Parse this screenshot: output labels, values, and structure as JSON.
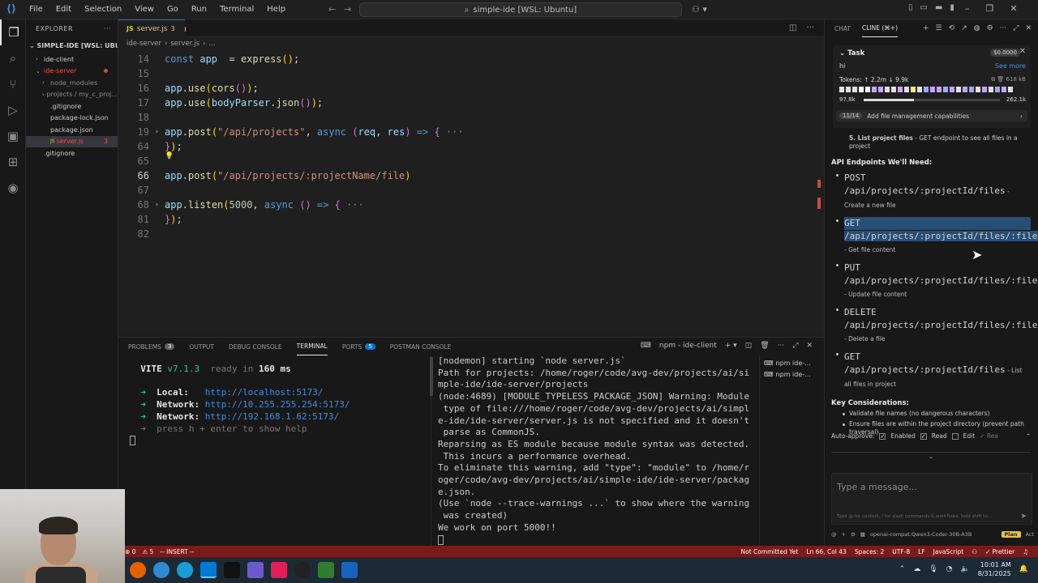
{
  "titlebar": {
    "menu": [
      "File",
      "Edit",
      "Selection",
      "View",
      "Go",
      "Run",
      "Terminal",
      "Help"
    ],
    "search": "simple-ide [WSL: Ubuntu]"
  },
  "explorer": {
    "header": "EXPLORER",
    "section": "SIMPLE-IDE [WSL: UBUNTU]",
    "items": [
      {
        "label": "ide-client",
        "indent": 1,
        "folder": true,
        "open": false
      },
      {
        "label": "ide-server",
        "indent": 1,
        "folder": true,
        "open": true
      },
      {
        "label": "node_modules",
        "indent": 2,
        "folder": true,
        "open": false
      },
      {
        "label": "projects / my_c_proj...",
        "indent": 2,
        "folder": true,
        "open": false
      },
      {
        "label": ".gitignore",
        "indent": 2,
        "folder": false
      },
      {
        "label": "package-lock.json",
        "indent": 2,
        "folder": false
      },
      {
        "label": "package.json",
        "indent": 2,
        "folder": false
      },
      {
        "label": "server.js",
        "indent": 2,
        "folder": false,
        "count": "3"
      },
      {
        "label": ".gitignore",
        "indent": 1,
        "folder": false
      }
    ]
  },
  "editor": {
    "tab": {
      "label": "server.js",
      "problems": "3"
    },
    "breadcrumb": [
      "ide-server",
      "server.js",
      "..."
    ],
    "lines": [
      {
        "n": "14",
        "fold": "",
        "segs": [
          [
            "kw",
            "const "
          ],
          [
            "var",
            "app"
          ],
          [
            "",
            "  = "
          ],
          [
            "fn",
            "express"
          ],
          [
            "pn",
            "()"
          ],
          [
            "",
            ";"
          ]
        ]
      },
      {
        "n": "15",
        "fold": "",
        "segs": []
      },
      {
        "n": "16",
        "fold": "",
        "segs": [
          [
            "var",
            "app"
          ],
          [
            "",
            "."
          ],
          [
            "fn",
            "use"
          ],
          [
            "pn",
            "("
          ],
          [
            "fn",
            "cors"
          ],
          [
            "pn2",
            "()"
          ],
          [
            "pn",
            ")"
          ],
          [
            "",
            ";"
          ]
        ]
      },
      {
        "n": "17",
        "fold": "",
        "segs": [
          [
            "var",
            "app"
          ],
          [
            "",
            "."
          ],
          [
            "fn",
            "use"
          ],
          [
            "pn",
            "("
          ],
          [
            "var",
            "bodyParser"
          ],
          [
            "",
            "."
          ],
          [
            "fn",
            "json"
          ],
          [
            "pn2",
            "()"
          ],
          [
            "pn",
            ")"
          ],
          [
            "",
            ";"
          ]
        ]
      },
      {
        "n": "18",
        "fold": "",
        "segs": []
      },
      {
        "n": "19",
        "fold": "›",
        "segs": [
          [
            "var",
            "app"
          ],
          [
            "",
            "."
          ],
          [
            "fn",
            "post"
          ],
          [
            "pn",
            "("
          ],
          [
            "str",
            "\"/api/projects\""
          ],
          [
            "",
            ", "
          ],
          [
            "kw",
            "async "
          ],
          [
            "pn2",
            "("
          ],
          [
            "var",
            "req"
          ],
          [
            "",
            ", "
          ],
          [
            "var",
            "res"
          ],
          [
            "pn2",
            ") "
          ],
          [
            "kw",
            "=> "
          ],
          [
            "pn2",
            "{"
          ],
          [
            "cm",
            " ···"
          ]
        ]
      },
      {
        "n": "64",
        "fold": "",
        "segs": [
          [
            "pn2",
            "}"
          ],
          [
            "pn",
            ")"
          ],
          [
            "",
            ";"
          ]
        ]
      },
      {
        "n": "65",
        "fold": "",
        "segs": []
      },
      {
        "n": "66",
        "fold": "",
        "segs": [
          [
            "var",
            "app"
          ],
          [
            "",
            "."
          ],
          [
            "fn",
            "post"
          ],
          [
            "pn",
            "("
          ],
          [
            "str",
            "\"/api/projects/:projectName/file"
          ],
          [
            "pn",
            ")"
          ]
        ],
        "current": true
      },
      {
        "n": "67",
        "fold": "",
        "segs": []
      },
      {
        "n": "68",
        "fold": "›",
        "segs": [
          [
            "var",
            "app"
          ],
          [
            "",
            "."
          ],
          [
            "fn",
            "listen"
          ],
          [
            "pn",
            "("
          ],
          [
            "num",
            "5000"
          ],
          [
            "",
            ", "
          ],
          [
            "kw",
            "async "
          ],
          [
            "pn2",
            "() "
          ],
          [
            "kw",
            "=> "
          ],
          [
            "pn2",
            "{"
          ],
          [
            "cm",
            " ···"
          ]
        ]
      },
      {
        "n": "81",
        "fold": "",
        "segs": [
          [
            "pn2",
            "}"
          ],
          [
            "pn",
            ")"
          ],
          [
            "",
            ";"
          ]
        ]
      },
      {
        "n": "82",
        "fold": "",
        "segs": []
      }
    ]
  },
  "panel": {
    "tabs": [
      {
        "label": "PROBLEMS",
        "badge": "3"
      },
      {
        "label": "OUTPUT"
      },
      {
        "label": "DEBUG CONSOLE"
      },
      {
        "label": "TERMINAL",
        "active": true
      },
      {
        "label": "PORTS",
        "badge": "5"
      },
      {
        "label": "POSTMAN CONSOLE"
      }
    ],
    "terminal_name": "npm - ide-client",
    "left_terminal": {
      "vite": "VITE",
      "version": "v7.1.3",
      "ready": "ready in",
      "ms": "160 ms",
      "local_label": "Local:",
      "local_url": "http://localhost:5173/",
      "net1_label": "Network:",
      "net1_url": "http://10.255.255.254:5173/",
      "net2_label": "Network:",
      "net2_url": "http://192.168.1.62:5173/",
      "help": "press h + enter to show help"
    },
    "right_terminal": [
      "[nodemon] starting `node server.js`",
      "Path for projects: /home/roger/code/avg-dev/projects/ai/si",
      "mple-ide/ide-server/projects",
      "(node:4689) [MODULE_TYPELESS_PACKAGE_JSON] Warning: Module",
      " type of file:///home/roger/code/avg-dev/projects/ai/simpl",
      "e-ide/ide-server/server.js is not specified and it doesn't",
      " parse as CommonJS.",
      "Reparsing as ES module because module syntax was detected.",
      " This incurs a performance overhead.",
      "To eliminate this warning, add \"type\": \"module\" to /home/r",
      "oger/code/avg-dev/projects/ai/simple-ide/ide-server/packag",
      "e.json.",
      "(Use `node --trace-warnings ...` to show where the warning",
      " was created)",
      "We work on port 5000!!"
    ],
    "sessions": [
      "npm ide-...",
      "npm ide-..."
    ]
  },
  "cline": {
    "tabs": [
      "CHAT",
      "CLINE (⌘+)"
    ],
    "task": {
      "title": "Task",
      "cost": "$0.0000",
      "message": "hi",
      "see_more": "See more",
      "tokens": "Tokens: ↑ 2.2m ↓ 9.9k",
      "size": "618 kB",
      "context_used": "97.8k",
      "context_max": "262.1k",
      "context_fraction": 0.37,
      "progress_pill": "11/14",
      "progress_label": "Add file management capabilities"
    },
    "step5_bold": "5. List project files",
    "step5_text": " - GET endpoint to see all files in a project",
    "endpoints_heading": "API Endpoints We'll Need:",
    "endpoints": [
      {
        "method": "POST",
        "path": "/api/projects/:projectId/files",
        "desc": "- Create a new file"
      },
      {
        "method": "GET",
        "path": "/api/projects/:projectId/files/:fileName",
        "desc": "- Get file content",
        "highlight": true
      },
      {
        "method": "PUT",
        "path": "/api/projects/:projectId/files/:fileName",
        "desc": "- Update file content"
      },
      {
        "method": "DELETE",
        "path": "/api/projects/:projectId/files/:fileName",
        "desc": "- Delete a file"
      },
      {
        "method": "GET",
        "path": "/api/projects/:projectId/files",
        "desc": "- List all files in project"
      }
    ],
    "considerations_heading": "Key Considerations:",
    "considerations": [
      "Validate file names (no dangerous characters)",
      "Ensure files are within the project directory (prevent path traversal)"
    ],
    "auto_approve": {
      "label": "Auto-approve:",
      "enabled": "Enabled",
      "read": "Read",
      "edit": "Edit",
      "rea": "Rea"
    },
    "input_placeholder": "Type a message...",
    "input_hint": "Type @ for context, / for slash commands & workflows, hold shift to...",
    "model": "openai-compat:Qwen3-Coder-30B-A3B",
    "plan": "Plan",
    "act": "Act"
  },
  "statusbar": {
    "errors": "⊗ 0",
    "warnings": "⚠ 5",
    "mode": "-- INSERT --",
    "git": "Not Committed Yet",
    "pos": "Ln 66, Col 43",
    "spaces": "Spaces: 2",
    "enc": "UTF-8",
    "eol": "LF",
    "lang": "JavaScript",
    "prettier": "✓ Prettier"
  },
  "taskbar": {
    "time": "10:01 AM",
    "date": "8/31/2025"
  },
  "colors": {
    "statusbar": "#7a1b1b",
    "accent": "#0078d4",
    "selection": "#264f78"
  }
}
